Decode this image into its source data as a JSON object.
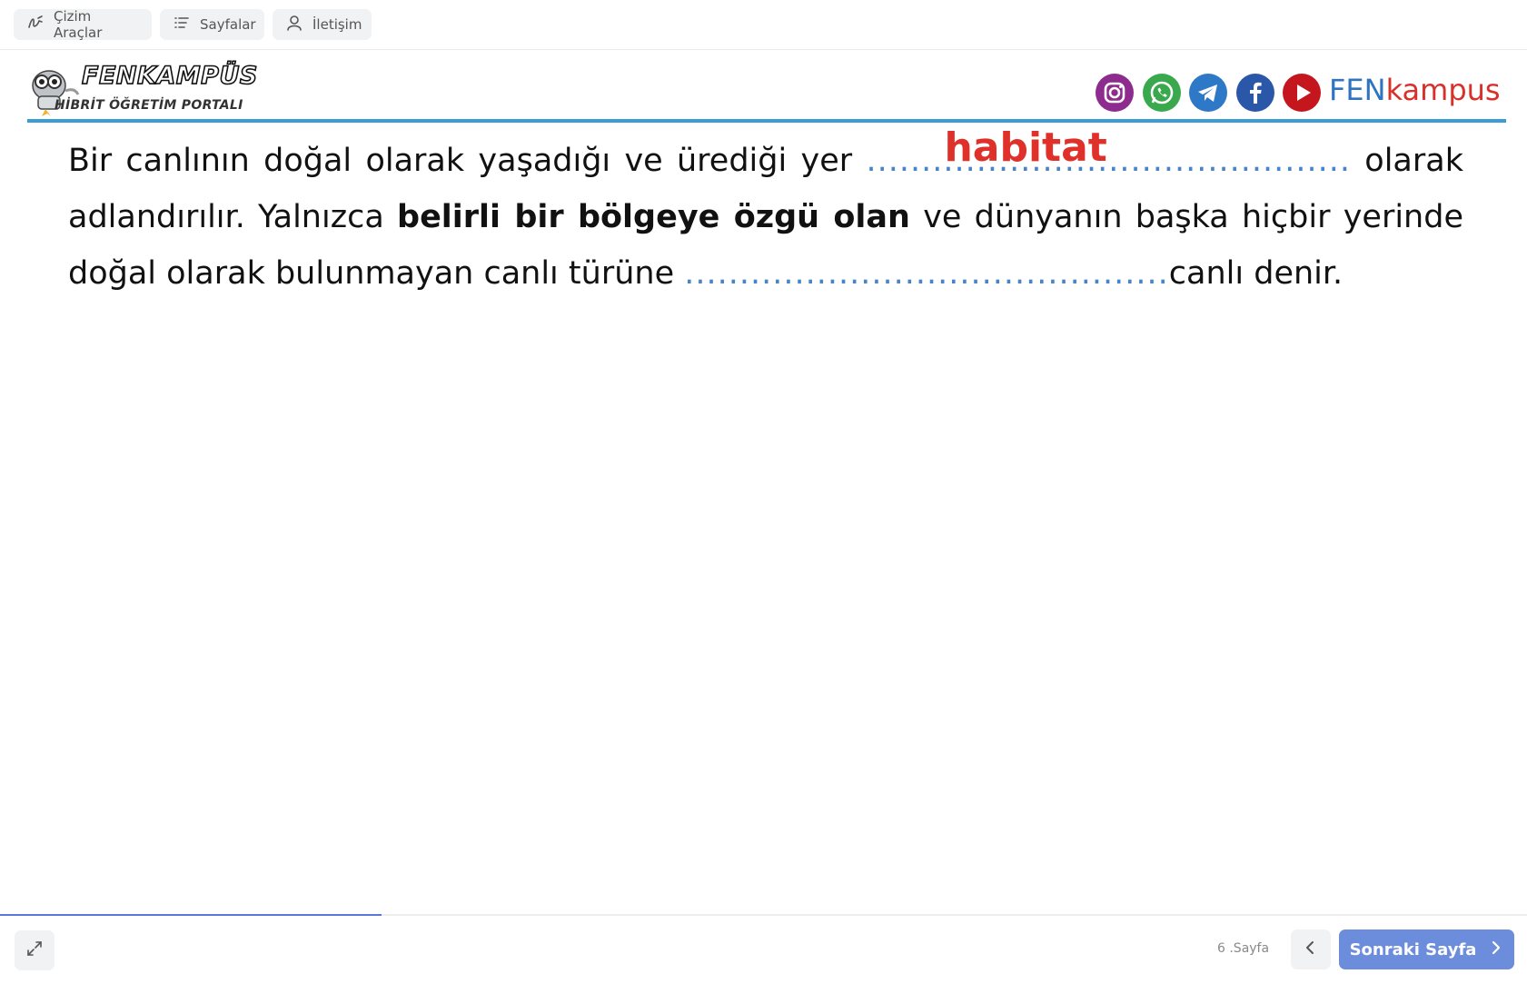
{
  "toolbar": {
    "draw_tools_label": "Çizim Araçlar",
    "pages_label": "Sayfalar",
    "contact_label": "İletişim"
  },
  "header": {
    "logo_title": "FENKAMPÜS",
    "logo_subtitle": "HİBRİT ÖĞRETİM PORTALI",
    "brand_part1": "FEN",
    "brand_part2": "kampus",
    "social_icons": [
      "instagram-icon",
      "whatsapp-icon",
      "telegram-icon",
      "facebook-icon",
      "youtube-icon"
    ],
    "colors": {
      "accent_rule": "#3d9bd6",
      "brand_blue": "#2f74c0",
      "brand_red": "#d8312b"
    }
  },
  "content": {
    "p1_start": "Bir canlının doğal olarak yaşadığı ve ürediği yer",
    "blank1_dots": "............................................",
    "blank1_answer": "habitat",
    "p1_mid": "olarak adlandırılır. Yalnızca",
    "bold_phrase": "belirli bir bölgeye özgü olan",
    "p1_mid2": "ve dünyanın başka hiçbir yerinde doğal olarak bulunmayan canlı türüne",
    "blank2_dots": "............................................",
    "p1_end": "canlı denir.",
    "answer_color": "#e0302a"
  },
  "footer": {
    "progress": 0.25,
    "page_label": "6 .Sayfa",
    "next_label": "Sonraki Sayfa"
  }
}
